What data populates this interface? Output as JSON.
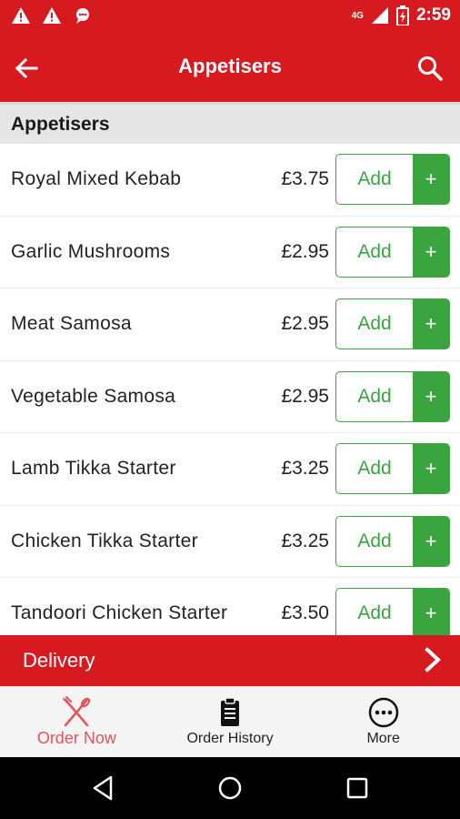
{
  "status_bar": {
    "network": "4G",
    "time": "2:59"
  },
  "app_bar": {
    "title": "Appetisers",
    "back_icon": "arrow-left-icon",
    "search_icon": "search-icon"
  },
  "section": {
    "title": "Appetisers"
  },
  "items": [
    {
      "name": "Royal Mixed Kebab",
      "price": "£3.75",
      "add_label": "Add",
      "plus_label": "+"
    },
    {
      "name": "Garlic Mushrooms",
      "price": "£2.95",
      "add_label": "Add",
      "plus_label": "+"
    },
    {
      "name": "Meat Samosa",
      "price": "£2.95",
      "add_label": "Add",
      "plus_label": "+"
    },
    {
      "name": "Vegetable Samosa",
      "price": "£2.95",
      "add_label": "Add",
      "plus_label": "+"
    },
    {
      "name": "Lamb Tikka Starter",
      "price": "£3.25",
      "add_label": "Add",
      "plus_label": "+"
    },
    {
      "name": "Chicken Tikka Starter",
      "price": "£3.25",
      "add_label": "Add",
      "plus_label": "+"
    },
    {
      "name": "Tandoori Chicken Starter",
      "price": "£3.50",
      "add_label": "Add",
      "plus_label": "+"
    }
  ],
  "delivery": {
    "label": "Delivery"
  },
  "bottom_nav": {
    "order_now": "Order Now",
    "order_history": "Order History",
    "more": "More"
  },
  "colors": {
    "brand_red": "#d71920",
    "accent_green": "#3aa43f",
    "active_nav": "#e05560"
  }
}
